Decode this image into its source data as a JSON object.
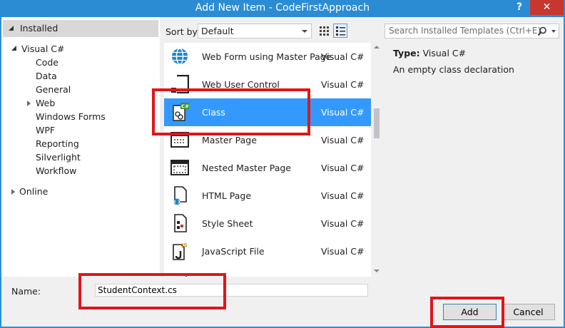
{
  "window": {
    "title": "Add New Item - CodeFirstApproach",
    "help": "?",
    "close": "✕"
  },
  "tree": {
    "installed": "Installed",
    "visual_csharp": "Visual C#",
    "children": [
      "Code",
      "Data",
      "General",
      "Web",
      "Windows Forms",
      "WPF",
      "Reporting",
      "Silverlight",
      "Workflow"
    ],
    "online": "Online"
  },
  "toolbar": {
    "sort_by_label": "Sort by:",
    "sort_by_value": "Default",
    "search_placeholder": "Search Installed Templates (Ctrl+E)"
  },
  "templates": [
    {
      "name": "Web Form using Master Page",
      "lang": "Visual C#",
      "icon": "globe-icon"
    },
    {
      "name": "Web User Control",
      "lang": "Visual C#",
      "icon": "user-control-icon"
    },
    {
      "name": "Class",
      "lang": "Visual C#",
      "icon": "class-csharp-icon",
      "selected": true
    },
    {
      "name": "Master Page",
      "lang": "Visual C#",
      "icon": "master-page-icon"
    },
    {
      "name": "Nested Master Page",
      "lang": "Visual C#",
      "icon": "nested-master-page-icon"
    },
    {
      "name": "HTML Page",
      "lang": "Visual C#",
      "icon": "html-page-icon"
    },
    {
      "name": "Style Sheet",
      "lang": "Visual C#",
      "icon": "style-sheet-icon"
    },
    {
      "name": "JavaScript File",
      "lang": "Visual C#",
      "icon": "javascript-file-icon"
    }
  ],
  "details": {
    "type_label": "Type:",
    "type_value": "Visual C#",
    "description": "An empty class declaration"
  },
  "name_field": {
    "label": "Name:",
    "value": "StudentContext.cs"
  },
  "buttons": {
    "add": "Add",
    "cancel": "Cancel"
  },
  "colors": {
    "titlebar": "#2b8cd4",
    "selection": "#3399ff",
    "annotation": "#e0151b",
    "close": "#c7372f"
  }
}
